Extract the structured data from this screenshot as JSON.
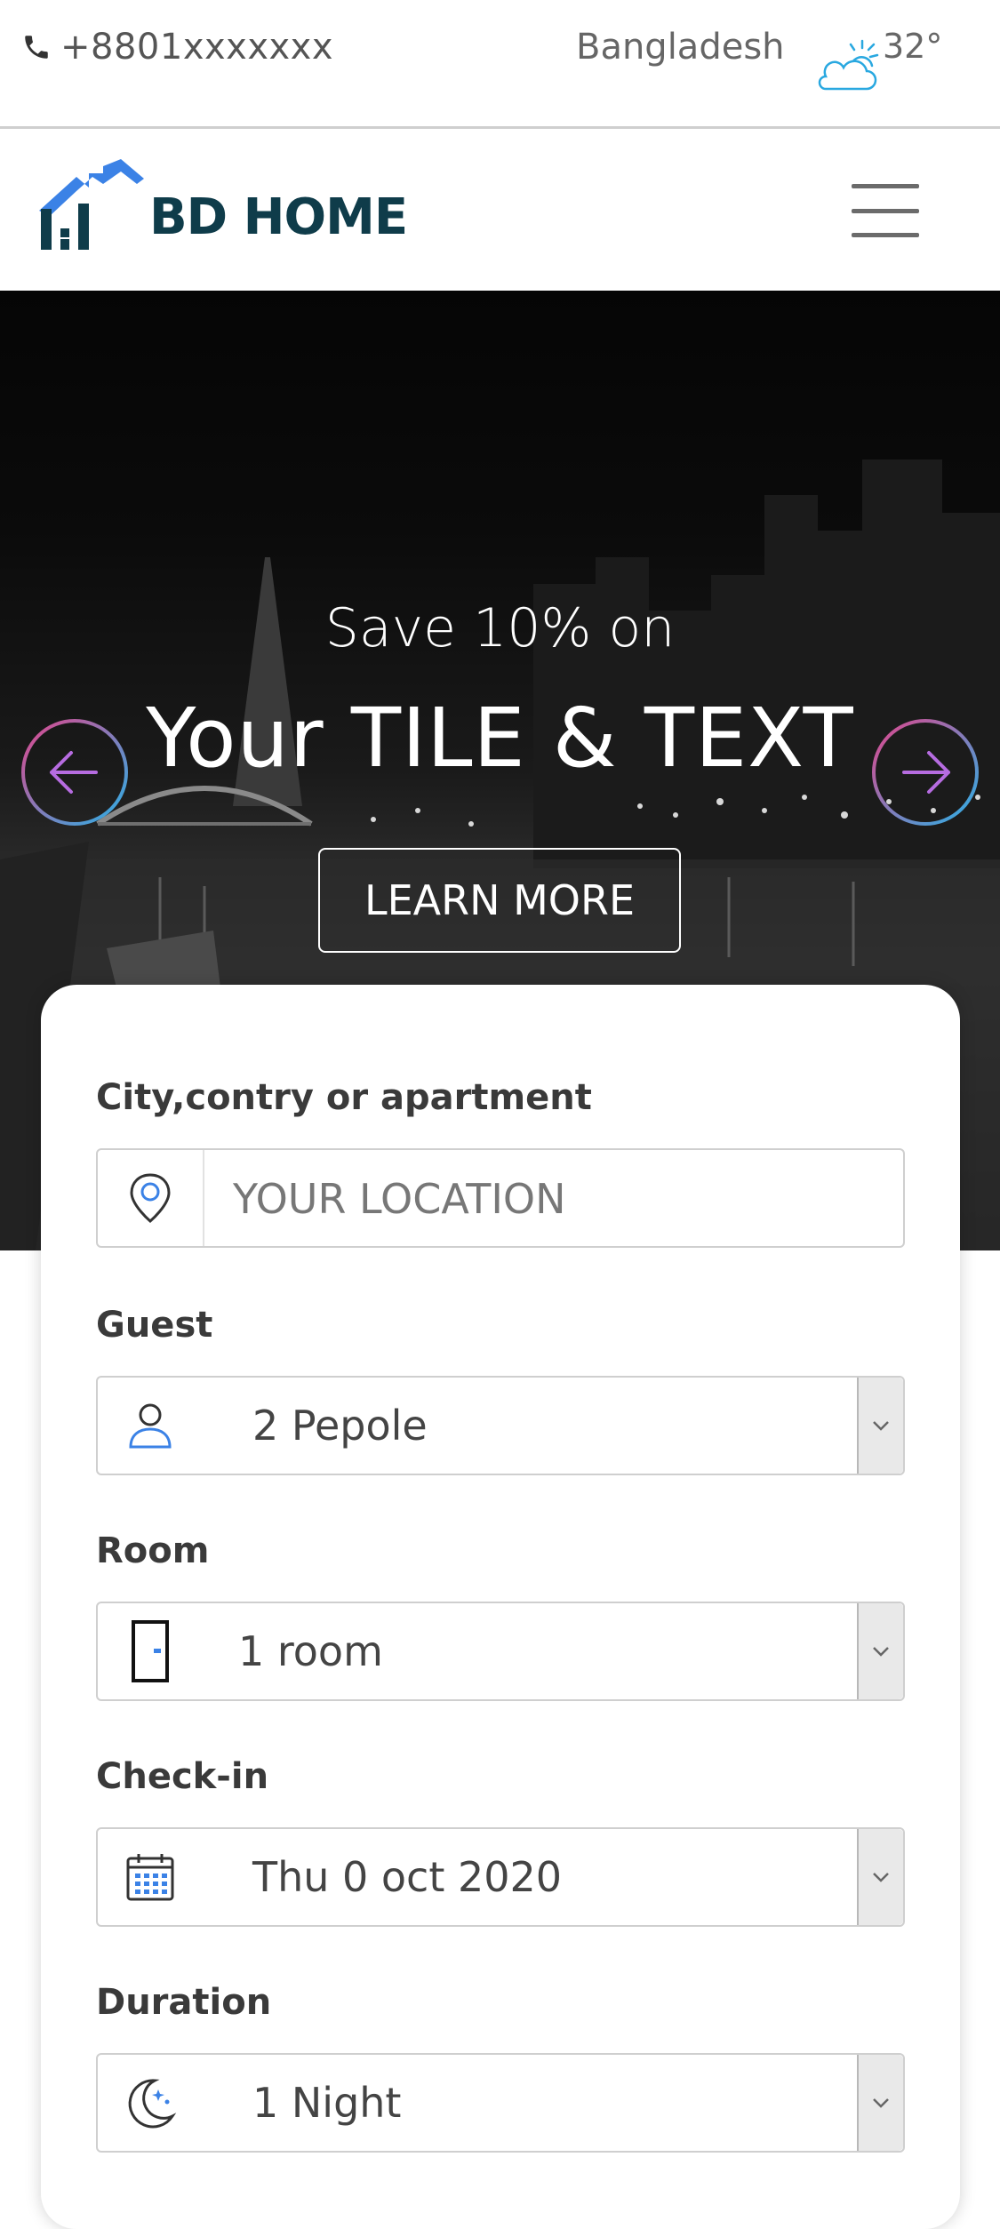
{
  "topbar": {
    "phone": "+8801xxxxxxx",
    "country": "Bangladesh",
    "temperature": "32°",
    "weather_icon": "partly-cloudy-icon"
  },
  "navbar": {
    "logo_text": "BD HOME",
    "menu_icon": "hamburger-icon"
  },
  "hero": {
    "subtitle": "Save 10% on",
    "title": "Your TILE & TEXT",
    "cta_label": "LEARN MORE",
    "prev_icon": "arrow-left-icon",
    "next_icon": "arrow-right-icon"
  },
  "search": {
    "location": {
      "label": "City,contry or apartment",
      "placeholder": "YOUR LOCATION",
      "icon": "location-pin-icon"
    },
    "guest": {
      "label": "Guest",
      "value": "2 Pepole",
      "icon": "person-icon"
    },
    "room": {
      "label": "Room",
      "value": "1 room",
      "icon": "door-icon"
    },
    "checkin": {
      "label": "Check-in",
      "value": "Thu 0 oct 2020",
      "icon": "calendar-icon"
    },
    "duration": {
      "label": "Duration",
      "value": "1 Night",
      "icon": "moon-icon"
    }
  },
  "colors": {
    "logo_blue": "#3b82e6",
    "logo_dark": "#0f3c4a",
    "arrow_ring_start": "#e0468c",
    "arrow_ring_end": "#2ab0e6"
  }
}
